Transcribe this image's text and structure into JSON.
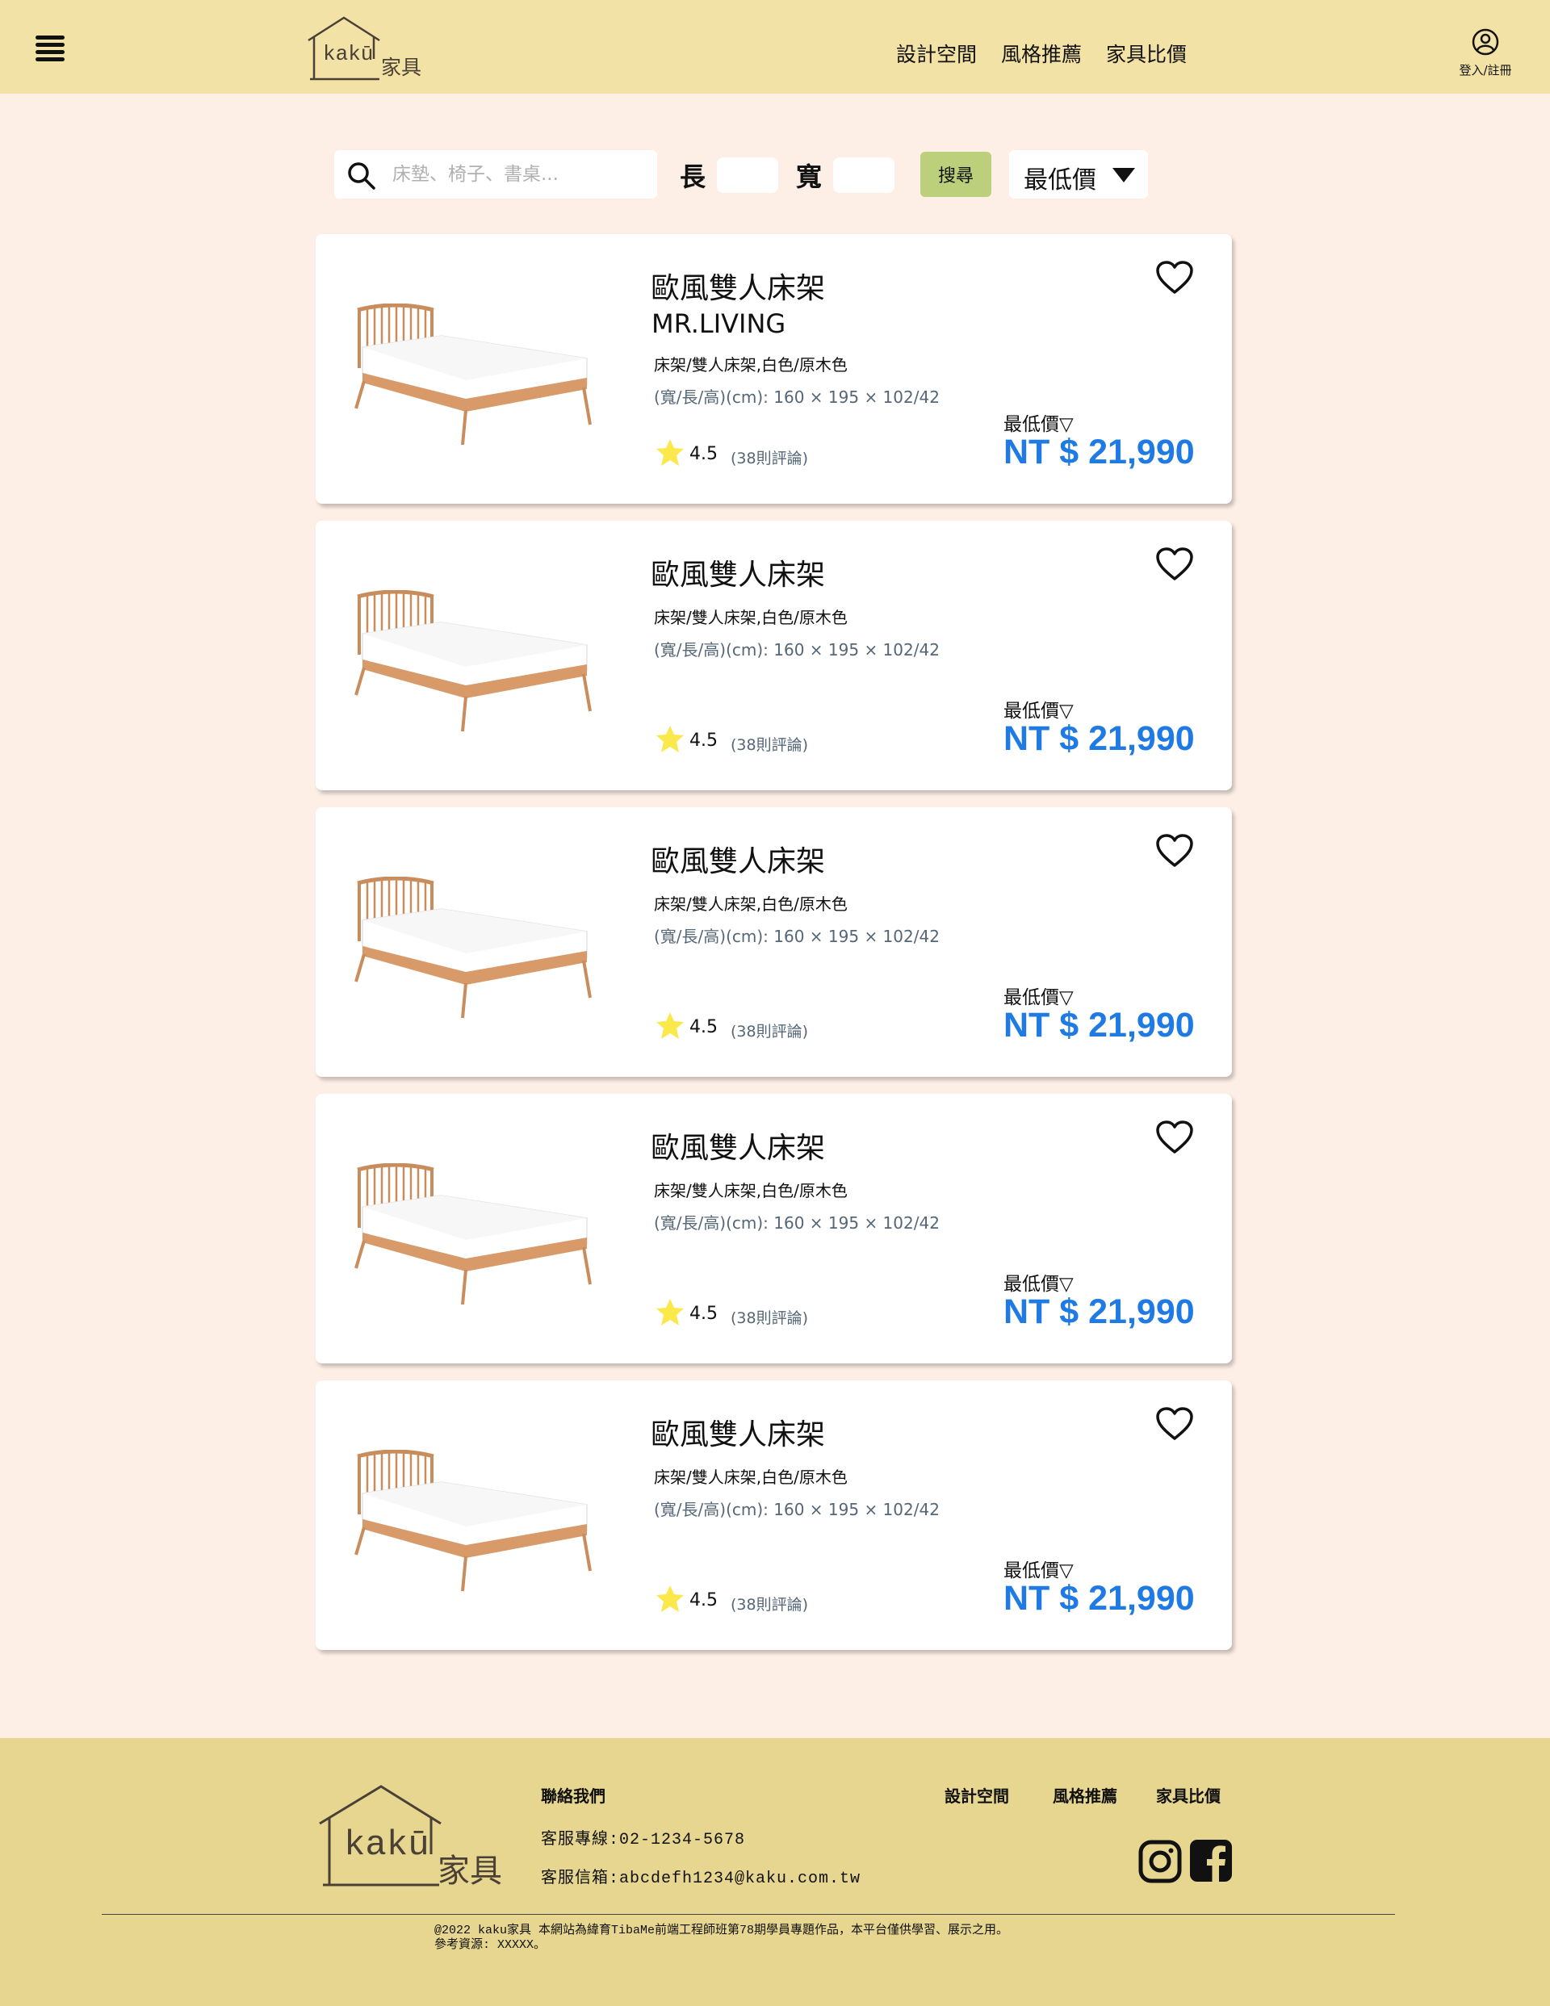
{
  "header": {
    "logo_latin": "kakū",
    "logo_cjk": "家具",
    "nav": [
      "設計空間",
      "風格推薦",
      "家具比價"
    ],
    "login_label": "登入/註冊"
  },
  "search": {
    "placeholder": "床墊、椅子、書桌...",
    "length_label": "長",
    "width_label": "寬",
    "button_label": "搜尋",
    "sort_label": "最低價"
  },
  "products": [
    {
      "name": "歐風雙人床架",
      "brand": "MR.LIVING",
      "desc": "床架/雙人床架,白色/原木色",
      "dims": "(寬/長/高)(cm): 160 × 195 × 102/42",
      "rating": "4.5",
      "reviews": "(38則評論)",
      "price_label": "最低價▽",
      "price": "NT $ 21,990"
    },
    {
      "name": "歐風雙人床架",
      "brand": "",
      "desc": "床架/雙人床架,白色/原木色",
      "dims": "(寬/長/高)(cm): 160 × 195 × 102/42",
      "rating": "4.5",
      "reviews": "(38則評論)",
      "price_label": "最低價▽",
      "price": "NT $ 21,990"
    },
    {
      "name": "歐風雙人床架",
      "brand": "",
      "desc": "床架/雙人床架,白色/原木色",
      "dims": "(寬/長/高)(cm): 160 × 195 × 102/42",
      "rating": "4.5",
      "reviews": "(38則評論)",
      "price_label": "最低價▽",
      "price": "NT $ 21,990"
    },
    {
      "name": "歐風雙人床架",
      "brand": "",
      "desc": "床架/雙人床架,白色/原木色",
      "dims": "(寬/長/高)(cm): 160 × 195 × 102/42",
      "rating": "4.5",
      "reviews": "(38則評論)",
      "price_label": "最低價▽",
      "price": "NT $ 21,990"
    },
    {
      "name": "歐風雙人床架",
      "brand": "",
      "desc": "床架/雙人床架,白色/原木色",
      "dims": "(寬/長/高)(cm): 160 × 195 × 102/42",
      "rating": "4.5",
      "reviews": "(38則評論)",
      "price_label": "最低價▽",
      "price": "NT $ 21,990"
    }
  ],
  "footer": {
    "contact_heading": "聯絡我們",
    "phone": "客服專線:02-1234-5678",
    "email": "客服信箱:abcdefh1234@kaku.com.tw",
    "nav": [
      "設計空間",
      "風格推薦",
      "家具比價"
    ],
    "copyright": "@2022 kaku家具 本網站為緯育TibaMe前端工程師班第78期學員專題作品，本平台僅供學習、展示之用。",
    "references": "參考資源: XXXXX。"
  },
  "colors": {
    "header_bg": "#f3e2a5",
    "page_bg": "#fdeee6",
    "footer_bg": "#e6d68f",
    "price_blue": "#1f7be3",
    "search_button": "#bcd07b",
    "star": "#fbe84a"
  },
  "icons": [
    "menu-icon",
    "user-icon",
    "search-icon",
    "heart-icon",
    "star-icon",
    "instagram-icon",
    "facebook-icon"
  ]
}
